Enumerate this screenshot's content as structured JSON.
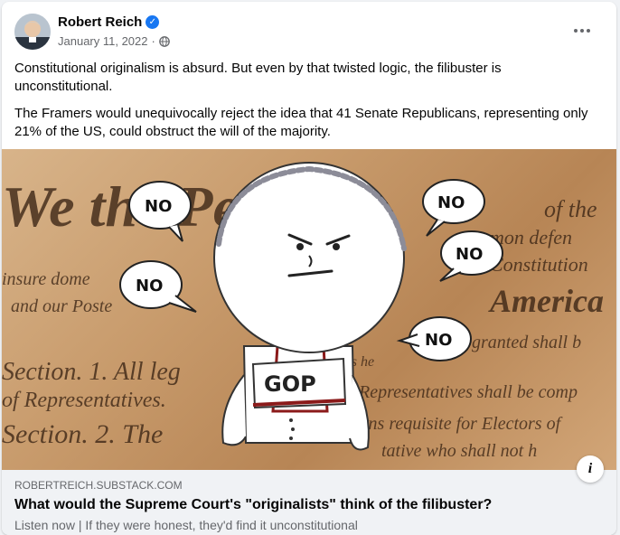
{
  "author": {
    "name": "Robert Reich",
    "verified_icon": "verified-badge-icon",
    "verified_color": "#1877f2"
  },
  "post": {
    "date": "January 11, 2022",
    "separator": "·",
    "audience_icon": "globe-icon",
    "paragraphs": [
      "Constitutional originalism is absurd. But even by that twisted logic, the filibuster is unconstitutional.",
      "The Framers would unequivocally reject the idea that 41 Senate Republicans, representing only 21% of the US, could obstruct the will of the majority."
    ]
  },
  "image": {
    "background_script": [
      "We the People",
      "of the",
      "mon defen",
      "Constitution",
      "America",
      "insure dome",
      "and our Poste",
      "Section. 1. All leg",
      "of Representatives.",
      "Section. 2. The",
      "Representatives shall be comp",
      "ions requisite for Electors of",
      "tative who shall not h",
      "granted shall b",
      "Powers he"
    ],
    "speech_bubbles": [
      "NO",
      "NO",
      "NO",
      "NO",
      "NO"
    ],
    "badge_text": "GOP"
  },
  "link_preview": {
    "domain": "ROBERTREICH.SUBSTACK.COM",
    "title": "What would the Supreme Court's \"originalists\" think of the filibuster?",
    "description": "Listen now | If they were honest, they'd find it unconstitutional"
  },
  "icons": {
    "more": "more-options-icon",
    "info": "info-icon"
  }
}
